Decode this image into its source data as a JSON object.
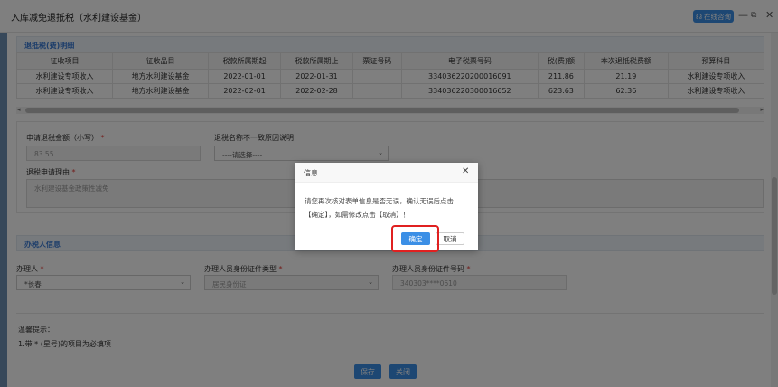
{
  "window": {
    "title": "入库减免退抵税（水利建设基金）",
    "online_label": "在线咨询"
  },
  "section_detail": {
    "title": "退抵税(费)明细"
  },
  "table": {
    "headers": [
      "征收项目",
      "征收品目",
      "税款所属期起",
      "税款所属期止",
      "票证号码",
      "电子税票号码",
      "税(费)额",
      "本次退抵税费额",
      "预算科目"
    ],
    "rows": [
      [
        "水利建设专项收入",
        "地方水利建设基金",
        "2022-01-01",
        "2022-01-31",
        "",
        "334036220200016091",
        "211.86",
        "21.19",
        "水利建设专项收入"
      ],
      [
        "水利建设专项收入",
        "地方水利建设基金",
        "2022-02-01",
        "2022-02-28",
        "",
        "334036220300016652",
        "623.63",
        "62.36",
        "水利建设专项收入"
      ]
    ]
  },
  "form": {
    "amount_label": "申请退税金额（小写）",
    "amount_value": "83.55",
    "mismatch_label": "退税名称不一致原因说明",
    "mismatch_value": "----请选择----",
    "reason_label": "退税申请理由",
    "reason_value": "水利建设基金政策性减免"
  },
  "section_handler": {
    "title": "办税人信息"
  },
  "handler": {
    "person_label": "办理人",
    "person_value": "*长春",
    "idtype_label": "办理人员身份证件类型",
    "idtype_value": "居民身份证",
    "idno_label": "办理人员身份证件号码",
    "idno_value": "340303****0610"
  },
  "tips": {
    "title": "温馨提示：",
    "text": "1.带 * (星号)的项目为必填项"
  },
  "buttons": {
    "save": "保存",
    "close": "关闭"
  },
  "dialog": {
    "title": "信息",
    "line1": "请您再次核对表单信息是否无误，确认无误后点击",
    "line2": "【确定】，如需修改点击【取消】！",
    "ok": "确定",
    "cancel": "取消"
  },
  "colors": {
    "accent": "#3b8fe6",
    "highlight": "#e02020",
    "required": "#e53935"
  }
}
